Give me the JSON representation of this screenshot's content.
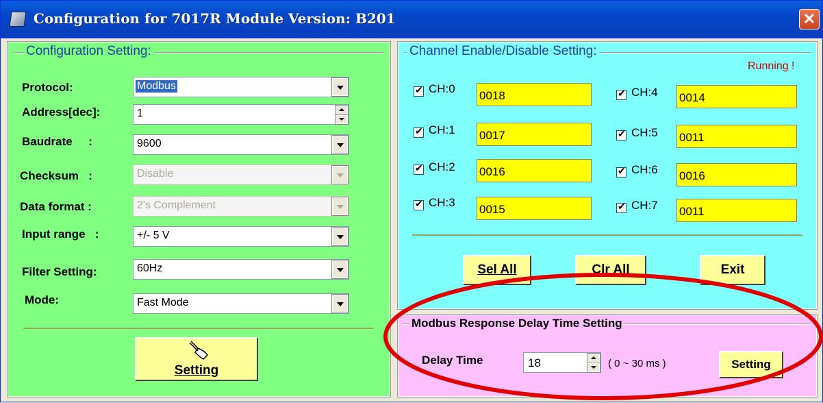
{
  "window": {
    "title": "Configuration for 7017R Module Version: B201",
    "close_label": "✕"
  },
  "config": {
    "legend": "Configuration Setting:",
    "protocol": {
      "label": "Protocol:",
      "value": "Modbus"
    },
    "address": {
      "label": "Address[dec]:",
      "value": "1"
    },
    "baudrate": {
      "label": "Baudrate     :",
      "value": "9600"
    },
    "checksum": {
      "label": "Checksum   :",
      "value": "Disable"
    },
    "data_format": {
      "label": "Data format :",
      "value": "2's Complement"
    },
    "input_range": {
      "label": "Input range   :",
      "value": "+/- 5 V"
    },
    "filter": {
      "label": "Filter Setting:",
      "value": "60Hz"
    },
    "mode": {
      "label": "Mode:",
      "value": "Fast Mode"
    },
    "setting_button": "Setting"
  },
  "channels": {
    "legend": "Channel Enable/Disable Setting:",
    "status": "Running !",
    "items": [
      {
        "label": "CH:0",
        "value": "0018",
        "checked": true
      },
      {
        "label": "CH:1",
        "value": "0017",
        "checked": true
      },
      {
        "label": "CH:2",
        "value": "0016",
        "checked": true
      },
      {
        "label": "CH:3",
        "value": "0015",
        "checked": true
      },
      {
        "label": "CH:4",
        "value": "0014",
        "checked": true
      },
      {
        "label": "CH:5",
        "value": "0011",
        "checked": true
      },
      {
        "label": "CH:6",
        "value": "0016",
        "checked": true
      },
      {
        "label": "CH:7",
        "value": "0011",
        "checked": true
      }
    ],
    "sel_all": "Sel All",
    "clr_all": "Clr All",
    "exit": "Exit"
  },
  "delay": {
    "legend": "Modbus Response Delay Time Setting",
    "label": "Delay Time",
    "value": "18",
    "range": "( 0 ~ 30 ms )",
    "setting_button": "Setting"
  },
  "colors": {
    "config_bg": "#80ff80",
    "channel_bg": "#80ffff",
    "delay_bg": "#ffc0ff",
    "button_bg": "#ffff99",
    "value_bg": "#ffff00",
    "highlight_ellipse": "#e00000"
  }
}
